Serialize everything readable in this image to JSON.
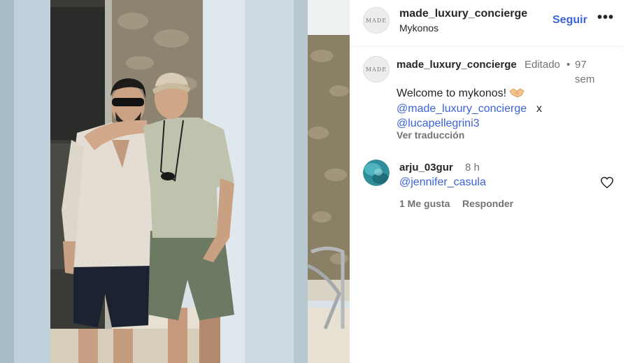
{
  "header": {
    "avatar_logo": "MADE",
    "username": "made_luxury_concierge",
    "location": "Mykonos",
    "follow_label": "Seguir",
    "more_icon": "more-horizontal-icon",
    "more_label": "•••"
  },
  "caption": {
    "avatar_logo": "MADE",
    "username": "made_luxury_concierge",
    "edited_label": "Editado",
    "separator": "•",
    "time": "97 sem",
    "text": "Welcome to mykonos!",
    "emoji": "handshake-emoji",
    "mention_1": "@made_luxury_concierge",
    "connector": "x",
    "mention_2": "@lucapellegrini3",
    "translate_label": "Ver traducción"
  },
  "comment": {
    "username": "arju_03gur",
    "time": "8 h",
    "mention": "@jennifer_casula",
    "likes_label": "1 Me gusta",
    "reply_label": "Responder",
    "like_icon": "heart-outline-icon"
  },
  "colors": {
    "link_blue": "#3a63d6",
    "text_primary": "#262626",
    "text_secondary": "#737373"
  }
}
